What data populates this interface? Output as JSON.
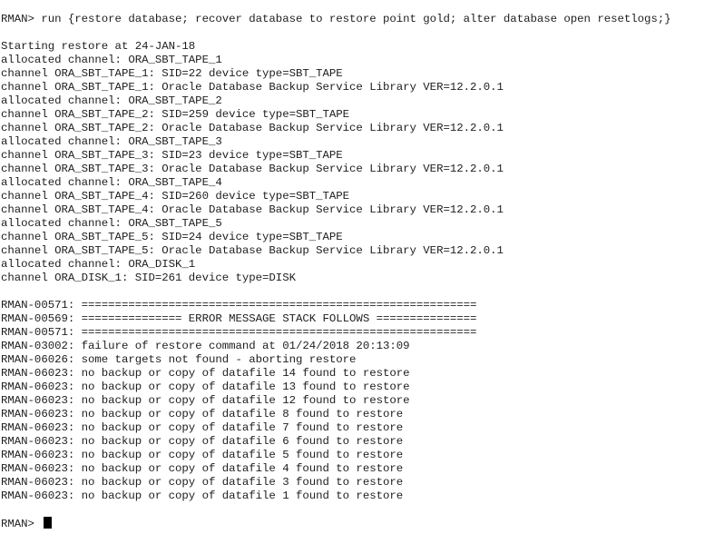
{
  "terminal": {
    "lines": [
      "RMAN> run {restore database; recover database to restore point gold; alter database open resetlogs;}",
      "",
      "Starting restore at 24-JAN-18",
      "allocated channel: ORA_SBT_TAPE_1",
      "channel ORA_SBT_TAPE_1: SID=22 device type=SBT_TAPE",
      "channel ORA_SBT_TAPE_1: Oracle Database Backup Service Library VER=12.2.0.1",
      "allocated channel: ORA_SBT_TAPE_2",
      "channel ORA_SBT_TAPE_2: SID=259 device type=SBT_TAPE",
      "channel ORA_SBT_TAPE_2: Oracle Database Backup Service Library VER=12.2.0.1",
      "allocated channel: ORA_SBT_TAPE_3",
      "channel ORA_SBT_TAPE_3: SID=23 device type=SBT_TAPE",
      "channel ORA_SBT_TAPE_3: Oracle Database Backup Service Library VER=12.2.0.1",
      "allocated channel: ORA_SBT_TAPE_4",
      "channel ORA_SBT_TAPE_4: SID=260 device type=SBT_TAPE",
      "channel ORA_SBT_TAPE_4: Oracle Database Backup Service Library VER=12.2.0.1",
      "allocated channel: ORA_SBT_TAPE_5",
      "channel ORA_SBT_TAPE_5: SID=24 device type=SBT_TAPE",
      "channel ORA_SBT_TAPE_5: Oracle Database Backup Service Library VER=12.2.0.1",
      "allocated channel: ORA_DISK_1",
      "channel ORA_DISK_1: SID=261 device type=DISK",
      "",
      "RMAN-00571: ===========================================================",
      "RMAN-00569: =============== ERROR MESSAGE STACK FOLLOWS ===============",
      "RMAN-00571: ===========================================================",
      "RMAN-03002: failure of restore command at 01/24/2018 20:13:09",
      "RMAN-06026: some targets not found - aborting restore",
      "RMAN-06023: no backup or copy of datafile 14 found to restore",
      "RMAN-06023: no backup or copy of datafile 13 found to restore",
      "RMAN-06023: no backup or copy of datafile 12 found to restore",
      "RMAN-06023: no backup or copy of datafile 8 found to restore",
      "RMAN-06023: no backup or copy of datafile 7 found to restore",
      "RMAN-06023: no backup or copy of datafile 6 found to restore",
      "RMAN-06023: no backup or copy of datafile 5 found to restore",
      "RMAN-06023: no backup or copy of datafile 4 found to restore",
      "RMAN-06023: no backup or copy of datafile 3 found to restore",
      "RMAN-06023: no backup or copy of datafile 1 found to restore",
      ""
    ],
    "prompt": "RMAN> "
  }
}
